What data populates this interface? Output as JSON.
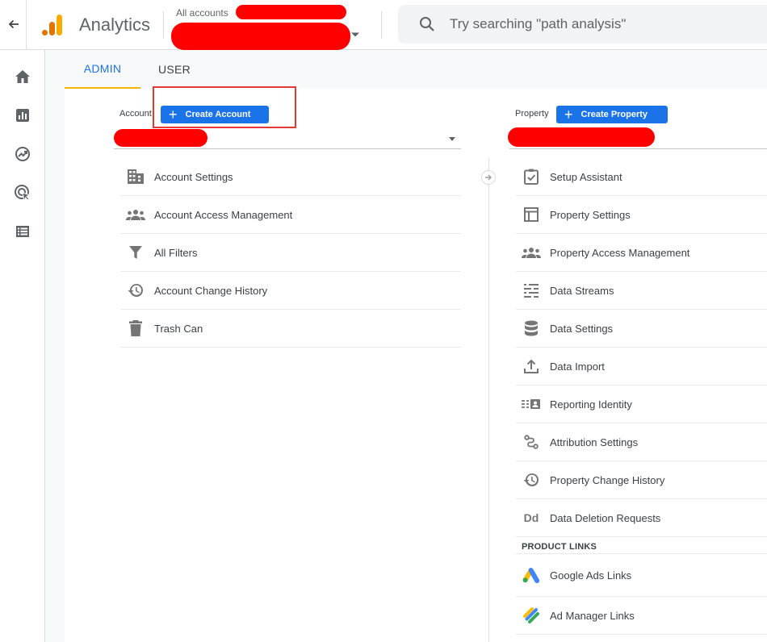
{
  "app": {
    "title": "Analytics"
  },
  "account_picker": {
    "label": "All accounts"
  },
  "search": {
    "placeholder": "Try searching \"path analysis\""
  },
  "tabs": [
    {
      "label": "ADMIN",
      "active": true
    },
    {
      "label": "USER",
      "active": false
    }
  ],
  "account_column": {
    "label": "Account",
    "create_button": "Create Account",
    "items": [
      {
        "label": "Account Settings",
        "icon": "building-icon"
      },
      {
        "label": "Account Access Management",
        "icon": "people-icon"
      },
      {
        "label": "All Filters",
        "icon": "filter-icon"
      },
      {
        "label": "Account Change History",
        "icon": "history-icon"
      },
      {
        "label": "Trash Can",
        "icon": "trash-icon"
      }
    ]
  },
  "property_column": {
    "label": "Property",
    "create_button": "Create Property",
    "items": [
      {
        "label": "Setup Assistant",
        "icon": "checklist-icon"
      },
      {
        "label": "Property Settings",
        "icon": "layout-icon"
      },
      {
        "label": "Property Access Management",
        "icon": "people-icon"
      },
      {
        "label": "Data Streams",
        "icon": "streams-icon"
      },
      {
        "label": "Data Settings",
        "icon": "database-icon"
      },
      {
        "label": "Data Import",
        "icon": "upload-icon"
      },
      {
        "label": "Reporting Identity",
        "icon": "identity-icon"
      },
      {
        "label": "Attribution Settings",
        "icon": "attribution-icon"
      },
      {
        "label": "Property Change History",
        "icon": "history-icon"
      },
      {
        "label": "Data Deletion Requests",
        "icon": "data-deletion-icon"
      }
    ],
    "product_links_heading": "PRODUCT LINKS",
    "product_links": [
      {
        "label": "Google Ads Links",
        "icon": "google-ads-icon"
      },
      {
        "label": "Ad Manager Links",
        "icon": "ad-manager-icon"
      }
    ],
    "deletion_icon_text": "Dd"
  },
  "colors": {
    "accent_blue": "#1a73e8",
    "tab_underline": "#f4b400",
    "redaction": "#ff0000",
    "highlight_box": "#e53935"
  }
}
